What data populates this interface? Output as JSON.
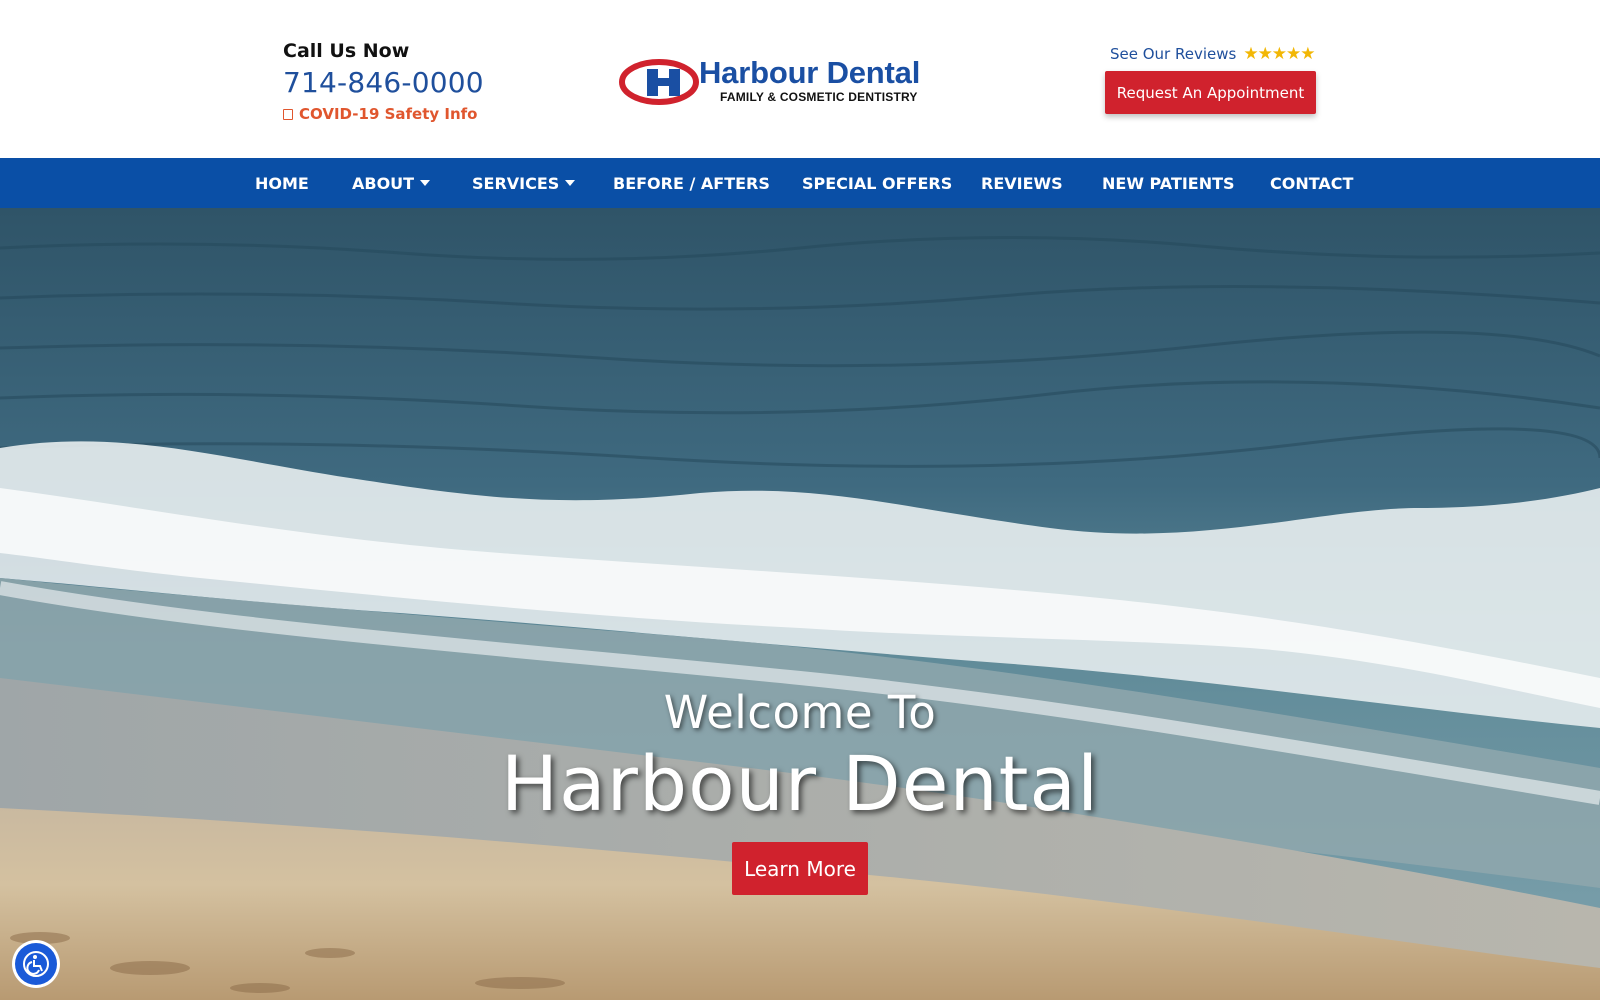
{
  "header": {
    "call_title": "Call Us Now",
    "phone": "714-846-0000",
    "covid_link": "COVID-19 Safety Info",
    "logo": {
      "name": "Harbour Dental",
      "tagline": "FAMILY & COSMETIC DENTISTRY",
      "colors": {
        "blue": "#1a4fa3",
        "red": "#d0222d"
      }
    },
    "reviews_link": "See Our Reviews",
    "stars": "★★★★★",
    "appointment_button": "Request An Appointment"
  },
  "nav": {
    "items": [
      {
        "label": "HOME",
        "has_dropdown": false
      },
      {
        "label": "ABOUT",
        "has_dropdown": true
      },
      {
        "label": "SERVICES",
        "has_dropdown": true
      },
      {
        "label": "BEFORE / AFTERS",
        "has_dropdown": false
      },
      {
        "label": "SPECIAL OFFERS",
        "has_dropdown": false
      },
      {
        "label": "REVIEWS",
        "has_dropdown": false
      },
      {
        "label": "NEW PATIENTS",
        "has_dropdown": false
      },
      {
        "label": "CONTACT",
        "has_dropdown": false
      }
    ]
  },
  "hero": {
    "welcome": "Welcome To",
    "title": "Harbour Dental",
    "button": "Learn More"
  },
  "accessibility": {
    "icon": "accessibility-icon"
  },
  "colors": {
    "nav_bg": "#0a4fa6",
    "accent_red": "#d0222d",
    "phone_blue": "#1f4f9c",
    "covid_orange": "#e0562e",
    "star_gold": "#f2b705"
  }
}
